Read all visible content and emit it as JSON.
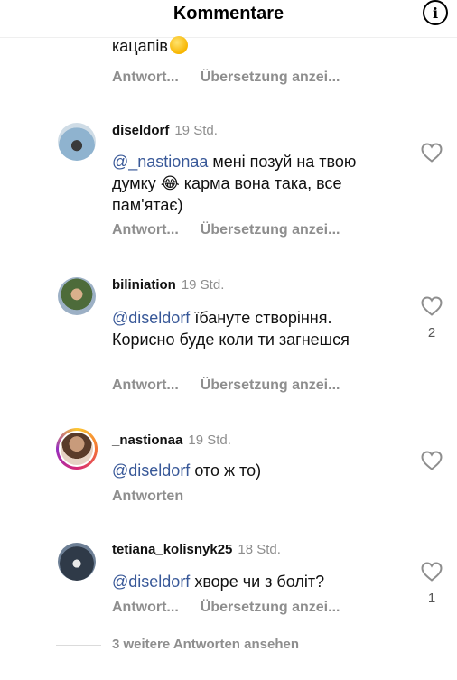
{
  "header": {
    "title": "Kommentare",
    "info_icon": "info-icon"
  },
  "partial_comment": {
    "text_end": "кацапів",
    "emoji": "winking-face",
    "actions": [
      "Antwort...",
      "Übersetzung anzei..."
    ]
  },
  "comments": [
    {
      "username": "diseldorf",
      "time": "19 Std.",
      "mention": "@_nastionaa",
      "text": " мені позуй на твою думку 😂 карма вона така, все пам'ятає)",
      "actions": [
        "Antwort...",
        "Übersetzung anzei..."
      ],
      "likes": ""
    },
    {
      "username": "biliniation",
      "time": "19 Std.",
      "mention": "@diseldorf",
      "text": " їбануте створіння. Корисно буде коли ти загнешся",
      "actions": [
        "Antwort...",
        "Übersetzung anzei..."
      ],
      "likes": "2"
    },
    {
      "username": "_nastionaa",
      "time": "19 Std.",
      "mention": "@diseldorf",
      "text": " ото ж то)",
      "actions": [
        "Antworten"
      ],
      "likes": ""
    },
    {
      "username": "tetiana_kolisnyk25",
      "time": "18 Std.",
      "mention": "@diseldorf",
      "text": " хворе чи з болiт?",
      "actions": [
        "Antwort...",
        "Übersetzung anzei..."
      ],
      "likes": "1"
    }
  ],
  "more_replies": "3 weitere Antworten ansehen",
  "colors": {
    "mention": "#385898",
    "secondary_text": "#8e8e8e"
  }
}
